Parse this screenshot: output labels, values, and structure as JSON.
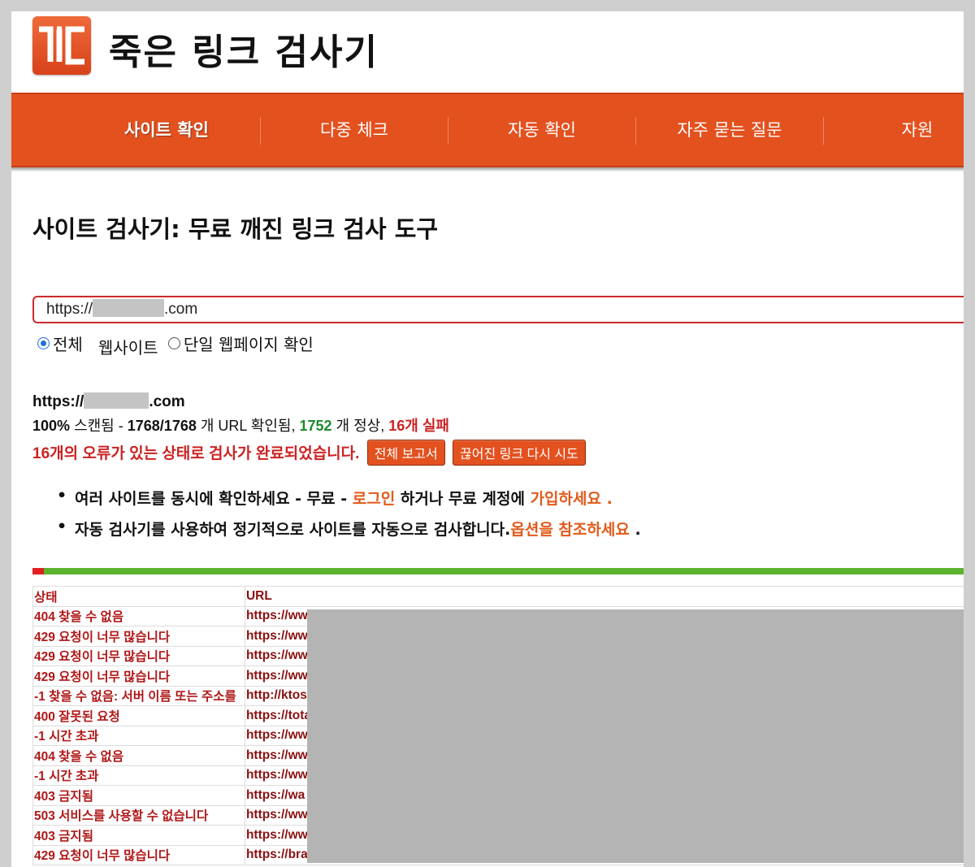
{
  "header": {
    "logo_text": "ㄱㄷ",
    "title": "죽은 링크 검사기"
  },
  "nav": {
    "items": [
      {
        "label": "사이트 확인"
      },
      {
        "label": "다중 체크"
      },
      {
        "label": "자동 확인"
      },
      {
        "label": "자주 묻는 질문"
      },
      {
        "label": "자원"
      }
    ]
  },
  "main": {
    "heading": "사이트 검사기: 무료 깨진 링크 검사 도구",
    "url_input": {
      "prefix": "https://",
      "suffix": ".com"
    },
    "radio": {
      "option1_a": "전체",
      "option1_b": "웹사이트",
      "option2": "단일 웹페이지 확인"
    },
    "result": {
      "url_prefix": "https://",
      "url_suffix": ".com",
      "scan_pct": "100%",
      "scanned_label": "스캔됨 -",
      "checked": "1768/1768",
      "checked_label": "개 URL 확인됨,",
      "ok_count": "1752",
      "ok_label": "개 정상,",
      "fail_text": "16개 실패",
      "done_text": "16개의 오류가 있는 상태로 검사가 완료되었습니다.",
      "btn_full_report": "전체 보고서",
      "btn_retry": "끊어진 링크 다시 시도"
    },
    "bullets": {
      "b1_a": "여러 사이트를 동시에 확인하세요 - 무료 -",
      "b1_login": "로그인",
      "b1_b": "하거나 무료 계정에",
      "b1_signup": "가입하세요 .",
      "b2_a": "자동 검사기를 사용하여 정기적으로 사이트를 자동으로 검사합니다.",
      "b2_link": "옵션을 참조하세요",
      "b2_b": "."
    },
    "progress": {
      "failed_fraction": 0.009
    },
    "table": {
      "headers": [
        "상태",
        "URL"
      ],
      "rows": [
        {
          "status": "404 찾을 수 없음",
          "url": "https://ww"
        },
        {
          "status": "429 요청이 너무 많습니다",
          "url": "https://ww"
        },
        {
          "status": "429 요청이 너무 많습니다",
          "url": "https://ww"
        },
        {
          "status": "429 요청이 너무 많습니다",
          "url": "https://ww"
        },
        {
          "status": "-1 찾을 수 없음: 서버 이름 또는 주소를",
          "url": "http://ktos"
        },
        {
          "status": "400 잘못된 요청",
          "url": "https://tota"
        },
        {
          "status": "-1 시간 초과",
          "url": "https://ww"
        },
        {
          "status": "404 찾을 수 없음",
          "url": "https://ww"
        },
        {
          "status": "-1 시간 초과",
          "url": "https://ww"
        },
        {
          "status": "403 금지됨",
          "url": "https://wa"
        },
        {
          "status": "503 서비스를 사용할 수 없습니다",
          "url": "https://ww"
        },
        {
          "status": "403 금지됨",
          "url": "https://ww"
        },
        {
          "status": "429 요청이 너무 많습니다",
          "url": "https://bra"
        }
      ]
    }
  },
  "colors": {
    "brand": "#e3511f",
    "ok": "#1d8a2a",
    "error": "#cc2222",
    "progress_ok": "#5cb32e",
    "progress_fail": "#e02020"
  }
}
